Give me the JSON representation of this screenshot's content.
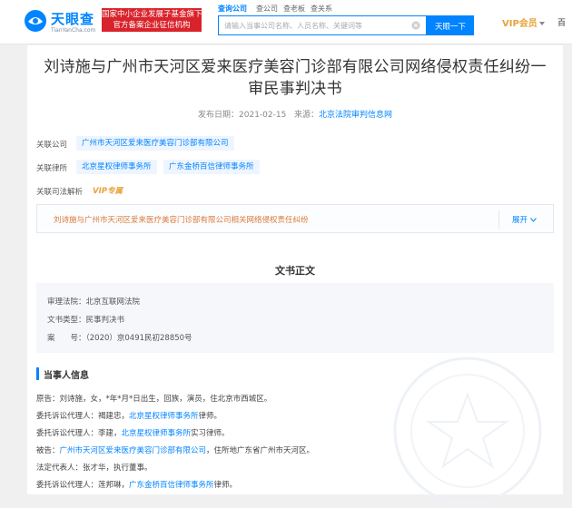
{
  "header": {
    "logo_cn": "天眼查",
    "logo_en": "TianYanCha.com",
    "gov_line1": "国家中小企业发展子基金旗下",
    "gov_line2": "官方备案企业征信机构",
    "search_tabs": [
      "查询公司",
      "查公司",
      "查老板",
      "查关系"
    ],
    "search_placeholder": "请输入当事公司名称、人员名称、关键词等",
    "search_button": "天眼一下",
    "vip_label": "VIP会员",
    "more_label": "百",
    "brand_color": "#0084ff"
  },
  "doc": {
    "title": "刘诗施与广州市天河区爱来医疗美容门诊部有限公司网络侵权责任纠纷一审民事判决书",
    "publish_label": "发布日期：",
    "publish_date": "2021-02-15",
    "source_label": "来源：",
    "source_value": "北京法院审判信息网"
  },
  "related": {
    "company_label": "关联公司",
    "company": "广州市天河区爱来医疗美容门诊部有限公司",
    "lawfirm_label": "关联律所",
    "lawfirms": [
      "北京星权律师事务所",
      "广东金桥百信律师事务所"
    ],
    "analysis_label": "关联司法解析",
    "vip_tag": "VIP专属",
    "case_text": "刘诗施与广州市天河区爱来医疗美容门诊部有限公司相关网络侵权责任纠纷",
    "expand_label": "展开"
  },
  "body": {
    "section_title": "文书正文",
    "court_line": "审理法院：北京互联网法院",
    "type_line": "文书类型：民事判决书",
    "case_no_line": "案　　号：（2020）京0491民初28850号"
  },
  "parties": {
    "heading": "当事人信息",
    "lines": [
      {
        "prefix": "原告：刘诗施，女，*年*月*日出生，回族，演员，住北京市西城区。",
        "link": "",
        "suffix": ""
      },
      {
        "prefix": "委托诉讼代理人：褐建忠，",
        "link": "北京星权律师事务所",
        "suffix": "律师。"
      },
      {
        "prefix": "委托诉讼代理人：李建，",
        "link": "北京星权律师事务所",
        "suffix": "实习律师。"
      },
      {
        "prefix": "被告：",
        "link": "广州市天河区爱来医疗美容门诊部有限公司",
        "suffix": "，住所地广东省广州市天河区。"
      },
      {
        "prefix": "法定代表人：张才华，执行董事。",
        "link": "",
        "suffix": ""
      },
      {
        "prefix": "委托诉讼代理人：莲邦琳，",
        "link": "广东金桥百信律师事务所",
        "suffix": "律师。"
      }
    ]
  }
}
